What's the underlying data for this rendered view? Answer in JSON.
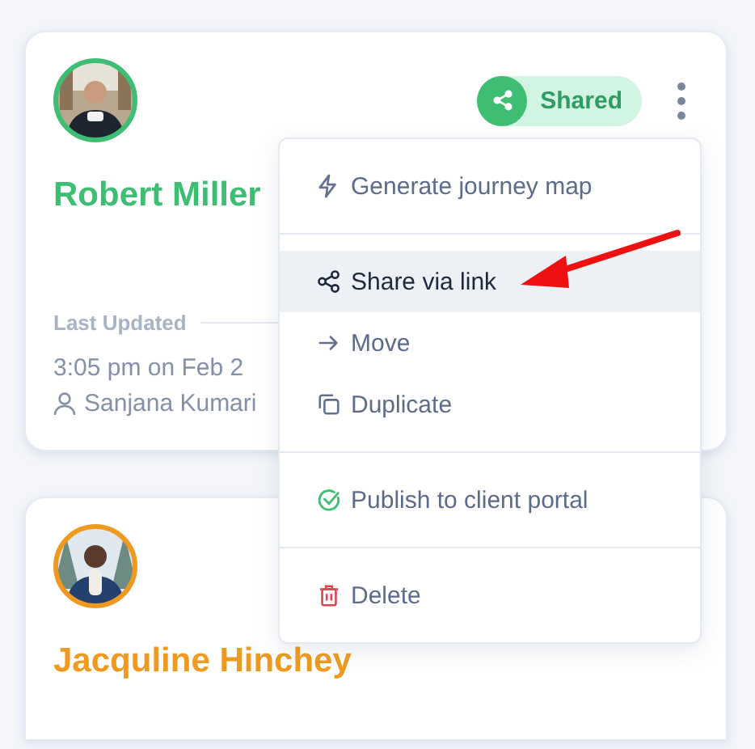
{
  "cards": [
    {
      "name": "Robert Miller",
      "color": "#3dbe73",
      "badge": "Shared",
      "last_updated_label": "Last Updated",
      "updated_time": "3:05 pm on Feb 2",
      "updated_by": "Sanjana Kumari"
    },
    {
      "name": "Jacquline Hinchey",
      "color": "#ef9a1e"
    }
  ],
  "menu": {
    "groups": [
      [
        {
          "label": "Generate journey map",
          "kind": "generate",
          "selected": false
        }
      ],
      [
        {
          "label": "Share via link",
          "kind": "share",
          "selected": true
        },
        {
          "label": "Move",
          "kind": "move",
          "selected": false
        },
        {
          "label": "Duplicate",
          "kind": "duplicate",
          "selected": false
        }
      ],
      [
        {
          "label": "Publish to client portal",
          "kind": "publish",
          "selected": false
        }
      ],
      [
        {
          "label": "Delete",
          "kind": "delete",
          "selected": false
        }
      ]
    ]
  }
}
